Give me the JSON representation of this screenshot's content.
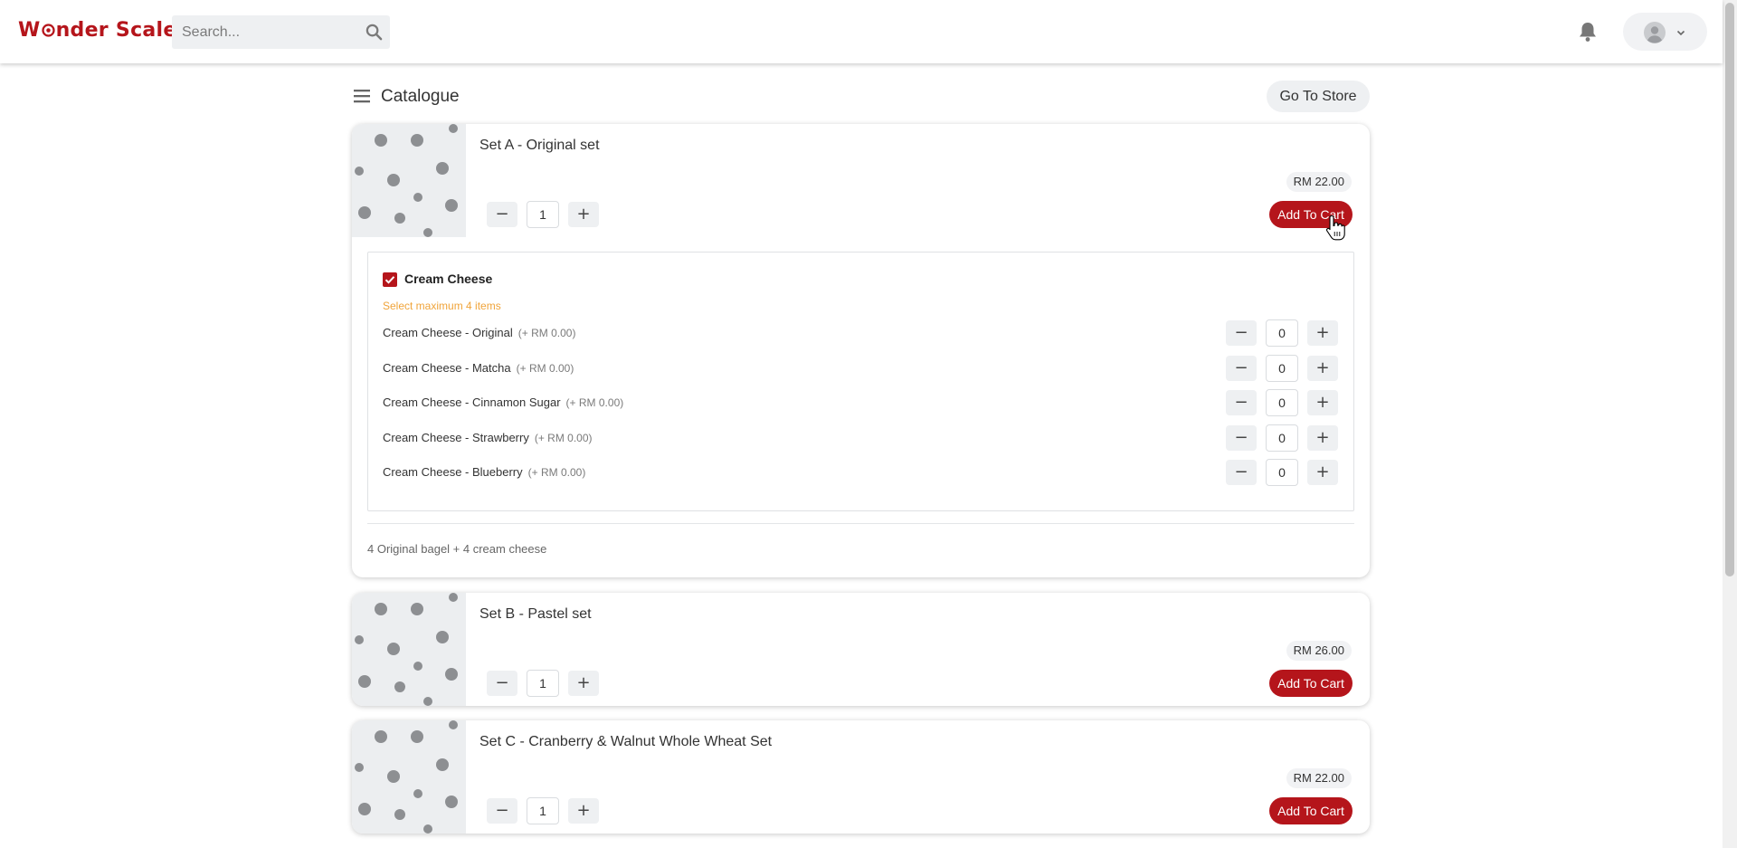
{
  "app": {
    "logo": "W✪nder Scale"
  },
  "search": {
    "placeholder": "Search..."
  },
  "header": {
    "title": "Catalogue",
    "go_store": "Go To Store"
  },
  "cards": [
    {
      "name": "Set A - Original set",
      "price": "RM 22.00",
      "qty": "1",
      "add_to_cart": "Add To Cart",
      "options": {
        "group": "Cream Cheese",
        "checked": true,
        "hint": "Select maximum 4 items",
        "items": [
          {
            "name": "Cream Cheese - Original",
            "price": "(+ RM 0.00)",
            "qty": "0"
          },
          {
            "name": "Cream Cheese - Matcha",
            "price": "(+ RM 0.00)",
            "qty": "0"
          },
          {
            "name": "Cream Cheese - Cinnamon Sugar",
            "price": "(+ RM 0.00)",
            "qty": "0"
          },
          {
            "name": "Cream Cheese - Strawberry",
            "price": "(+ RM 0.00)",
            "qty": "0"
          },
          {
            "name": "Cream Cheese - Blueberry",
            "price": "(+ RM 0.00)",
            "qty": "0"
          }
        ]
      },
      "description": "4 Original bagel + 4 cream cheese"
    },
    {
      "name": "Set B - Pastel set",
      "price": "RM 26.00",
      "qty": "1",
      "add_to_cart": "Add To Cart"
    },
    {
      "name": "Set C - Cranberry & Walnut Whole Wheat Set",
      "price": "RM 22.00",
      "qty": "1",
      "add_to_cart": "Add To Cart"
    }
  ],
  "icons": {
    "search": "search-icon",
    "bell": "bell-icon",
    "avatar": "user-avatar-icon",
    "chevron": "chevron-down-icon",
    "menu": "hamburger-menu-icon",
    "minus": "minus-icon",
    "plus": "plus-icon",
    "check": "checkbox-checked-icon",
    "cursor": "hand-pointer-cursor"
  },
  "colors": {
    "brand": "#b5151b",
    "hint": "#f0a43a",
    "button_bg": "#eef0f2"
  }
}
